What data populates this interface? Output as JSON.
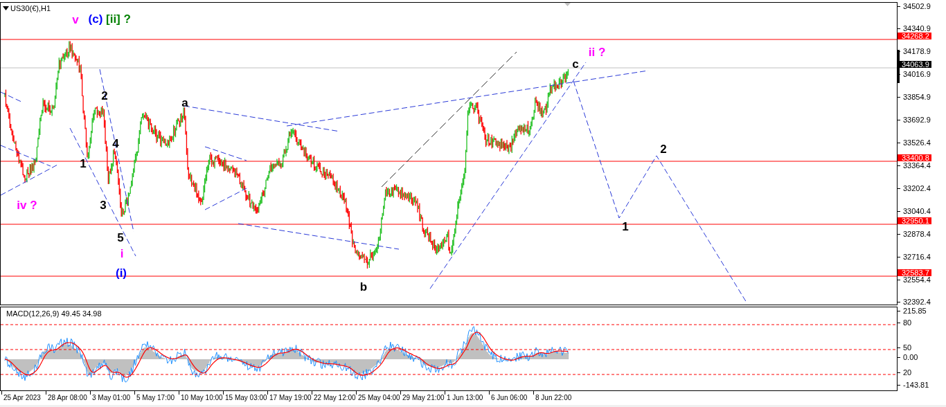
{
  "chart": {
    "symbol": "US30(€),H1",
    "wave_labels": [
      {
        "text": "v",
        "color": "#ff00ff"
      },
      {
        "text": "(c)",
        "color": "#0000ff"
      },
      {
        "text": "[ii] ?",
        "color": "#008000"
      },
      {
        "text": "2",
        "color": "#000000"
      },
      {
        "text": "4",
        "color": "#000000"
      },
      {
        "text": "1",
        "color": "#000000"
      },
      {
        "text": "3",
        "color": "#000000"
      },
      {
        "text": "5",
        "color": "#000000"
      },
      {
        "text": "i",
        "color": "#ff00ff"
      },
      {
        "text": "(i)",
        "color": "#0000ff"
      },
      {
        "text": "iv ?",
        "color": "#ff00ff"
      },
      {
        "text": "a",
        "color": "#000000"
      },
      {
        "text": "b",
        "color": "#000000"
      },
      {
        "text": "c",
        "color": "#000000"
      },
      {
        "text": "ii ?",
        "color": "#ff00ff"
      },
      {
        "text": "2",
        "color": "#000000"
      },
      {
        "text": "1",
        "color": "#000000"
      }
    ],
    "price_ticks": [
      "34502.9",
      "34340.9",
      "34178.9",
      "34016.9",
      "33854.9",
      "33692.9",
      "33526.4",
      "33364.4",
      "33202.4",
      "33040.4",
      "32878.4",
      "32716.4",
      "32554.4",
      "32392.4"
    ],
    "levels": [
      {
        "label": "34268.2",
        "kind": "level"
      },
      {
        "label": "34063.9",
        "kind": "current"
      },
      {
        "label": "33400.8",
        "kind": "level"
      },
      {
        "label": "32950.1",
        "kind": "level"
      },
      {
        "label": "32583.7",
        "kind": "level"
      }
    ]
  },
  "macd": {
    "label": "MACD(12,26,9) 49.45 34.98",
    "ticks": [
      "215.85",
      "80",
      "50",
      "0.00",
      "20",
      "-143.81"
    ]
  },
  "time_axis": [
    "25 Apr 2023",
    "28 Apr 08:00",
    "3 May 01:00",
    "5 May 17:00",
    "10 May 10:00",
    "15 May 03:00",
    "17 May 19:00",
    "22 May 12:00",
    "25 May 04:00",
    "29 May 21:00",
    "1 Jun 13:00",
    "6 Jun 06:00",
    "8 Jun 22:00"
  ]
}
